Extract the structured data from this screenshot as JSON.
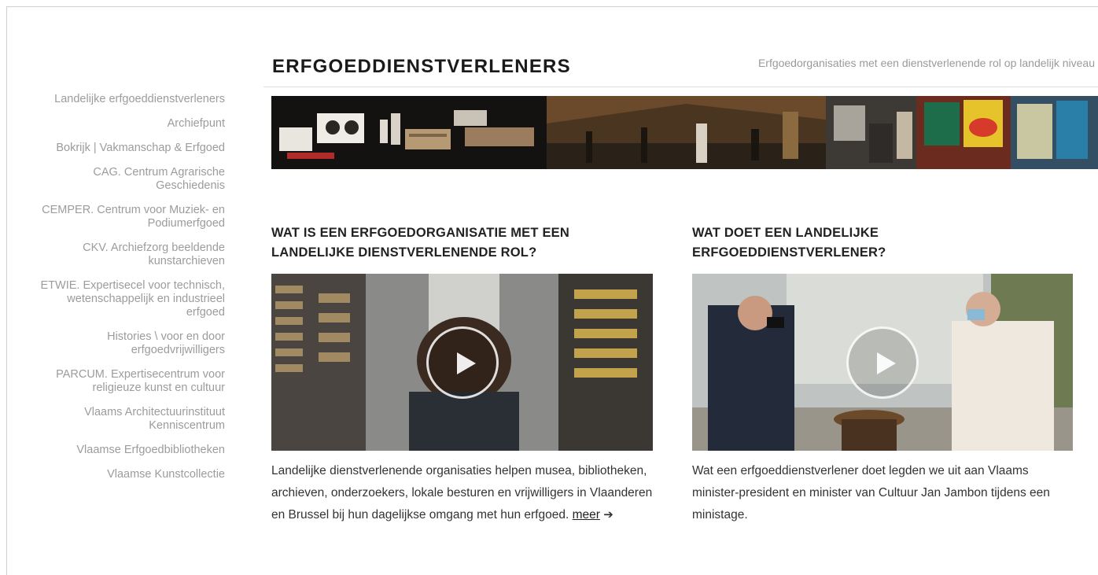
{
  "header": {
    "title": "ERFGOEDDIENSTVERLENERS",
    "subtitle": "Erfgoedorganisaties met een dienstverlenende rol op landelijk niveau"
  },
  "sidebar": {
    "items": [
      {
        "label": "Landelijke erfgoeddienstverleners"
      },
      {
        "label": "Archiefpunt"
      },
      {
        "label": "Bokrijk | Vakmanschap & Erfgoed"
      },
      {
        "label": "CAG. Centrum Agrarische Geschiedenis"
      },
      {
        "label": "CEMPER. Centrum voor Muziek- en Podiumerfgoed"
      },
      {
        "label": "CKV. Archiefzorg beeldende kunstarchieven"
      },
      {
        "label": "ETWIE. Expertisecel voor technisch, wetenschappelijk en industrieel erfgoed"
      },
      {
        "label": "Histories \\ voor en door erfgoedvrijwilligers"
      },
      {
        "label": "PARCUM. Expertisecentrum voor religieuze kunst en cultuur"
      },
      {
        "label": "Vlaams Architectuurinstituut Kenniscentrum"
      },
      {
        "label": "Vlaamse Erfgoedbibliotheken"
      },
      {
        "label": "Vlaamse Kunstcollectie"
      }
    ]
  },
  "main": {
    "left": {
      "heading": "WAT IS EEN ERFGOEDORGANISATIE MET EEN LANDELIJKE DIENSTVERLENENDE ROL?",
      "text": "Landelijke dienstverlenende organisaties helpen musea, bibliotheken, archieven, onderzoekers, lokale besturen en vrijwilligers in Vlaanderen en Brussel bij hun dagelijkse omgang met hun erfgoed.",
      "more_label": "meer",
      "arrow": "➔"
    },
    "right": {
      "heading": "WAT DOET EEN LANDELIJKE ERFGOEDDIENSTVERLENER?",
      "text": "Wat een erfgoeddienstverlener doet legden we uit aan Vlaams minister-president en minister van Cultuur Jan Jambon tijdens een ministage."
    }
  }
}
